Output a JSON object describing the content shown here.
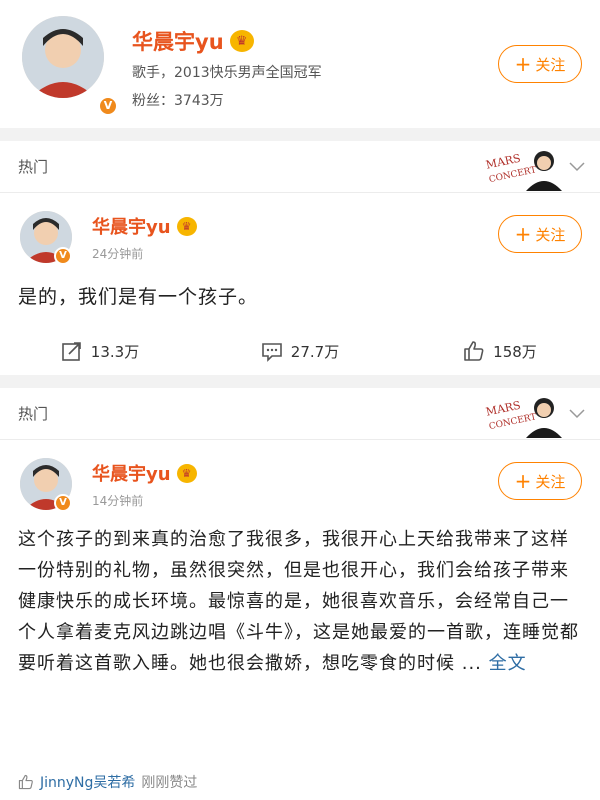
{
  "profile": {
    "name": "华晨宇yu",
    "description": "歌手，2013快乐男声全国冠军",
    "fans": "粉丝：3743万",
    "follow_label": "关注",
    "verified_mark": "V"
  },
  "feed": [
    {
      "section_label": "热门",
      "author": "华晨宇yu",
      "time": "24分钟前",
      "text": "是的，我们是有一个孩子。",
      "follow_label": "关注",
      "actions": {
        "repost": "13.3万",
        "comment": "27.7万",
        "like": "158万"
      }
    },
    {
      "section_label": "热门",
      "author": "华晨宇yu",
      "time": "14分钟前",
      "text": "这个孩子的到来真的治愈了我很多，我很开心上天给我带来了这样一份特别的礼物，虽然很突然，但是也很开心，我们会给孩子带来健康快乐的成长环境。最惊喜的是，她很喜欢音乐，会经常自己一个人拿着麦克风边跳边唱《斗牛》，这是她最爱的一首歌，连睡觉都要听着这首歌入睡。她也很会撒娇，想吃零食的时候 ...",
      "full_text_link": "全文",
      "follow_label": "关注",
      "liked_by": "JinnyNg吴若希",
      "liked_status": "刚刚赞过"
    }
  ],
  "colors": {
    "accent": "#ff8200",
    "name": "#e8541e",
    "link": "#2e6da4"
  }
}
